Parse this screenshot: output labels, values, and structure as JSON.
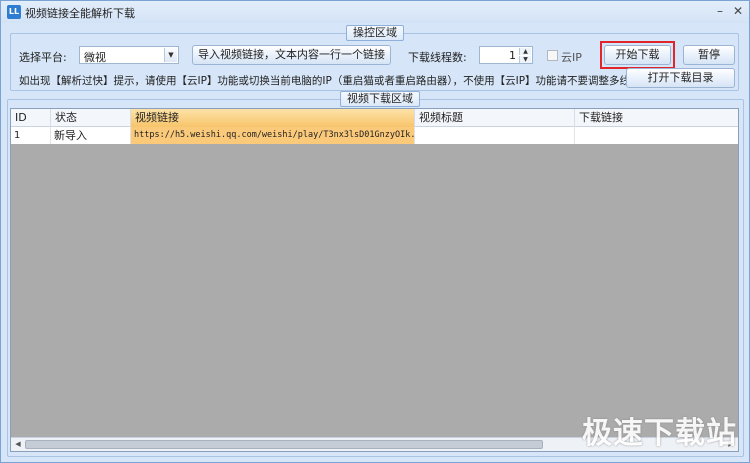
{
  "window": {
    "title": "视频链接全能解析下载",
    "icon_text": "LL"
  },
  "title_buttons": {
    "minimize": "–",
    "close": "✕"
  },
  "control_area": {
    "title": "操控区域",
    "platform_label": "选择平台:",
    "platform_value": "微视",
    "import_button": "导入视频链接，文本内容一行一个链接",
    "threads_label": "下载线程数:",
    "threads_value": "1",
    "cloud_ip_label": "云IP",
    "cloud_ip_checked": false,
    "start_button": "开始下载",
    "pause_button": "暂停",
    "hint": "如出现【解析过快】提示，请使用【云IP】功能或切换当前电脑的IP（重启猫或者重启路由器），不使用【云IP】功能请不要调整多线程",
    "open_dir_button": "打开下载目录"
  },
  "download_area": {
    "title": "视频下载区域",
    "columns": [
      "ID",
      "状态",
      "视频链接",
      "视频标题",
      "下载链接"
    ],
    "rows": [
      {
        "id": "1",
        "status": "新导入",
        "url": "https://h5.weishi.qq.com/weishi/play/T3nx3lsD01GnzyOIk...",
        "title": "",
        "download": ""
      }
    ]
  },
  "watermark": "极速下载站",
  "colors": {
    "accent_highlight": "#e0262a",
    "selected_cell": "#fbc97a"
  }
}
